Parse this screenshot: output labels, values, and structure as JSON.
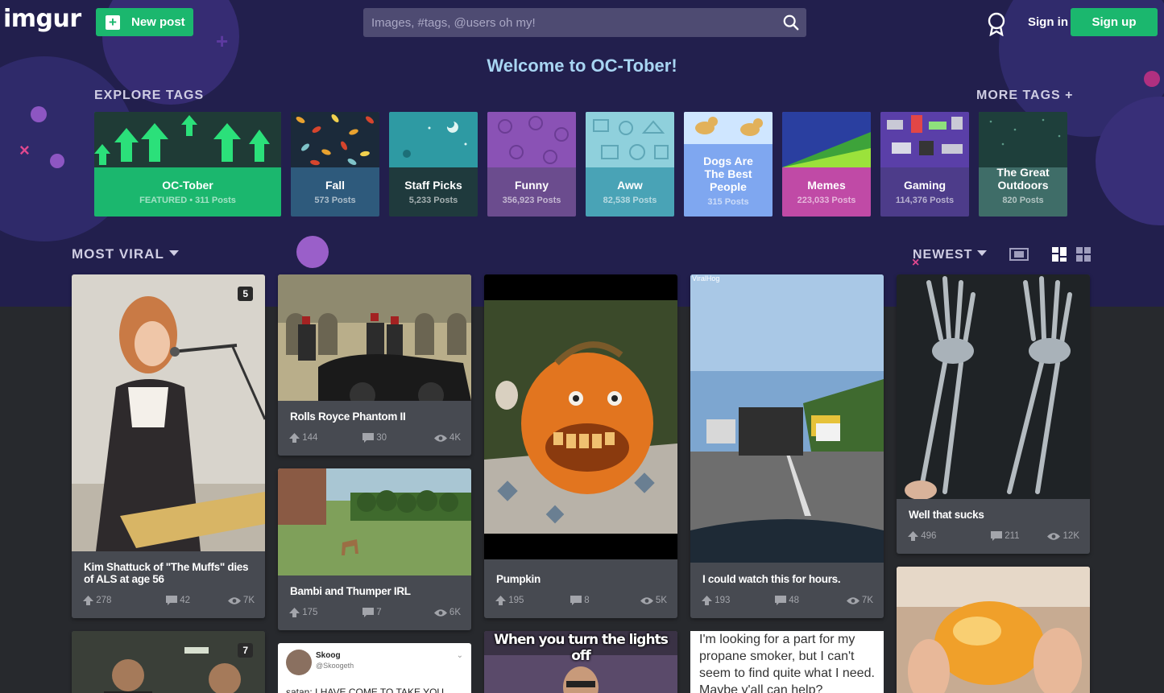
{
  "header": {
    "logo": "imgur",
    "new_post": "New post",
    "search_placeholder": "Images, #tags, @users oh my!",
    "sign_in": "Sign in",
    "sign_up": "Sign up"
  },
  "welcome": "Welcome to OC-Tober!",
  "explore_label": "EXPLORE TAGS",
  "more_tags": "MORE TAGS +",
  "tags": [
    {
      "name": "OC-Tober",
      "count": "FEATURED • 311 Posts",
      "color": "#1bb76e"
    },
    {
      "name": "Fall",
      "count": "573 Posts",
      "color": "#2e5a7c"
    },
    {
      "name": "Staff Picks",
      "count": "5,233 Posts",
      "color": "#1f3a3d"
    },
    {
      "name": "Funny",
      "count": "356,923 Posts",
      "color": "#6b4c8e"
    },
    {
      "name": "Aww",
      "count": "82,538 Posts",
      "color": "#49a3b6"
    },
    {
      "name": "Dogs Are The Best People",
      "count": "315 Posts",
      "color": "#7fa7f0"
    },
    {
      "name": "Memes",
      "count": "223,033 Posts",
      "color": "#c04aa6"
    },
    {
      "name": "Gaming",
      "count": "114,376 Posts",
      "color": "#4d3c8a"
    },
    {
      "name": "The Great Outdoors",
      "count": "820 Posts",
      "color": "#3f6d68"
    }
  ],
  "sort": {
    "section": "MOST VIRAL",
    "order": "NEWEST"
  },
  "posts": [
    {
      "title": "Kim Shattuck of \"The Muffs\" dies of ALS at age 56",
      "ups": "278",
      "comments": "42",
      "views": "7K",
      "badge": "5"
    },
    {
      "title": "Rolls Royce Phantom II",
      "ups": "144",
      "comments": "30",
      "views": "4K"
    },
    {
      "title": "Bambi and Thumper IRL",
      "ups": "175",
      "comments": "7",
      "views": "6K"
    },
    {
      "title": "Pumpkin",
      "ups": "195",
      "comments": "8",
      "views": "5K"
    },
    {
      "title": "I could watch this for hours.",
      "ups": "193",
      "comments": "48",
      "views": "7K",
      "watermark": "ViralHog"
    },
    {
      "title": "Well that sucks",
      "ups": "496",
      "comments": "211",
      "views": "12K"
    }
  ],
  "bottom": {
    "badge7": "7",
    "tweet_name": "Skoog",
    "tweet_handle": "@Skoogeth",
    "tweet_text": "satan: I HAVE COME TO TAKE YOU",
    "meme_caption": "When you turn the lights off",
    "text_post": "I'm looking for a part for my propane smoker, but I can't seem to find quite what I need. Maybe y'all can help?"
  }
}
